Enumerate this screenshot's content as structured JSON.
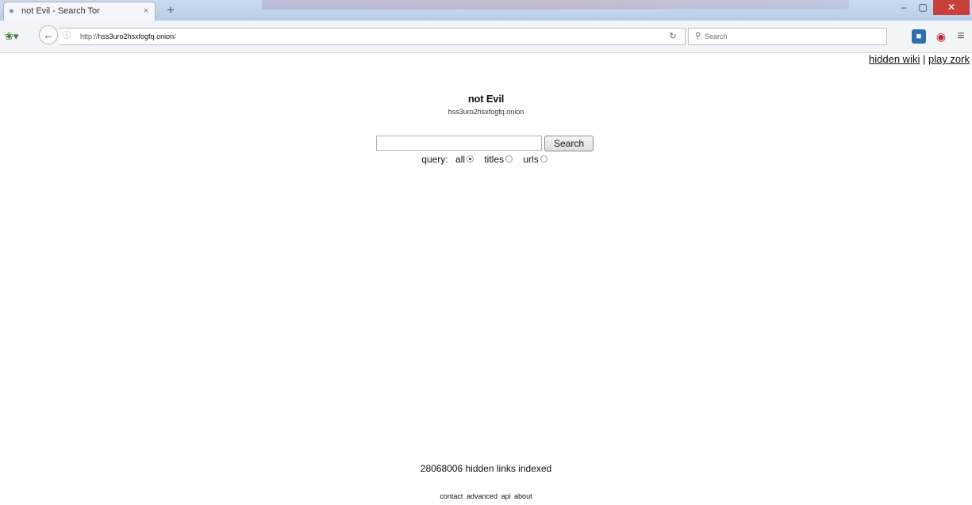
{
  "browser": {
    "tab_title": "not Evil - Search Tor",
    "tab_close": "×",
    "new_tab": "+",
    "window_controls": {
      "minimize": "–",
      "maximize": "▢",
      "close": "✕"
    },
    "back": "←",
    "url_prefix": "http://",
    "url_host": "hss3uro2hsxfogfq.onion",
    "url_suffix": "/",
    "reload": "↻",
    "search_placeholder": "Search",
    "icons": {
      "addon": "bug-icon",
      "pocket": "pocket-icon",
      "ublock": "ublock-icon",
      "menu": "hamburger-menu-icon"
    }
  },
  "page": {
    "top_links": {
      "first": "hidden wiki",
      "separator": " | ",
      "second": "play zork"
    },
    "title": "not Evil",
    "subtitle": "hss3uro2hsxfogfq.onion",
    "search_button": "Search",
    "filters": {
      "label": "query:",
      "options": [
        {
          "label": "all",
          "selected": true
        },
        {
          "label": "titles",
          "selected": false
        },
        {
          "label": "urls",
          "selected": false
        }
      ]
    },
    "indexed_text": "28068006 hidden links indexed",
    "footer": {
      "contact": "contact",
      "advanced": "advanced",
      "api": "api",
      "about": "about"
    }
  }
}
